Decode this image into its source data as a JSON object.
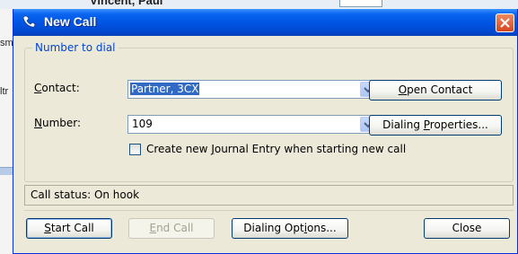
{
  "background": {
    "partial_name": "Vincent, Paul",
    "left_fragments": [
      "sm",
      "ltr"
    ]
  },
  "window": {
    "title": "New Call",
    "group_title": "Number to dial",
    "contact": {
      "label": "Contact:",
      "mnemonic": "C",
      "rest": "ontact:",
      "value": "Partner, 3CX"
    },
    "number": {
      "label": "Number:",
      "mnemonic": "N",
      "rest": "umber:",
      "value": "109"
    },
    "open_contact": {
      "pre": "",
      "mnemonic": "O",
      "rest": "pen Contact"
    },
    "dialing_properties": {
      "pre": "Dialing ",
      "mnemonic": "P",
      "rest": "roperties..."
    },
    "journal": {
      "pre": "Create new ",
      "mnemonic": "J",
      "rest": "ournal Entry when starting new call",
      "checked": false
    },
    "status": "Call status:  On hook",
    "buttons": {
      "start_call": {
        "pre": "",
        "mnemonic": "S",
        "rest": "tart Call"
      },
      "end_call": {
        "pre": "",
        "mnemonic": "E",
        "rest": "nd Call"
      },
      "dialing_options": {
        "pre": "Dialing Opt",
        "mnemonic": "i",
        "rest": "ons..."
      },
      "close": "Close"
    }
  },
  "colors": {
    "titlebar": "#0055e5",
    "dialog_bg": "#ece9d8",
    "group_title": "#0046d5",
    "selection": "#316ac5",
    "close_button": "#d6451f"
  }
}
